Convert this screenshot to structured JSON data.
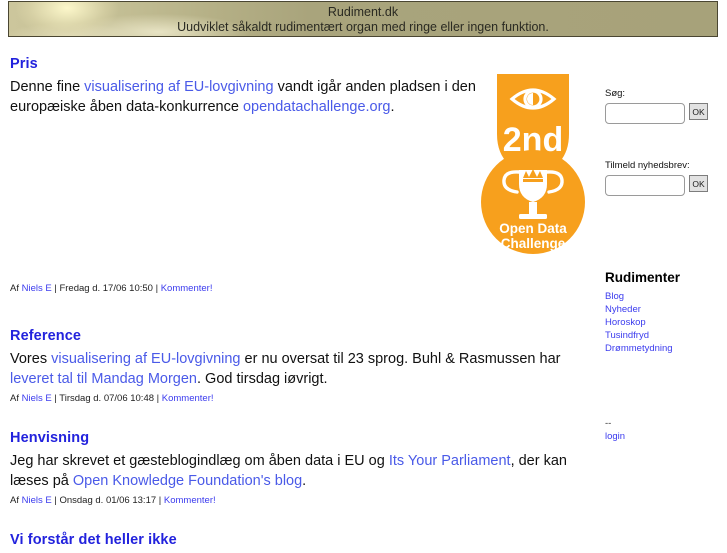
{
  "header": {
    "title": "Rudiment.dk",
    "tagline": "Uudviklet såkaldt rudimentært organ med ringe eller ingen funktion.",
    "banner_color": "#a9a47c",
    "banner_border_color": "#4a4632"
  },
  "theme": {
    "link_color": "#4a5ae8",
    "heading_color": "#2222dd",
    "accent_orange": "#f7a01d",
    "text_color": "#111111"
  },
  "posts": [
    {
      "id": "pris",
      "title": "Pris",
      "body_parts": [
        {
          "type": "text",
          "value": "Denne fine "
        },
        {
          "type": "link",
          "value": "visualisering af EU-lovgivning"
        },
        {
          "type": "text",
          "value": " vandt igår anden pladsen i den europæiske åben data-konkurrence "
        },
        {
          "type": "link",
          "value": "opendatachallenge.org"
        },
        {
          "type": "text",
          "value": "."
        }
      ],
      "meta": {
        "by_label": "Af",
        "author": "Niels E",
        "sep": "|",
        "date": "Fredag d. 17/06 10:50",
        "comment_label": "Kommenter!"
      }
    },
    {
      "id": "reference",
      "title": "Reference",
      "body_parts": [
        {
          "type": "text",
          "value": "Vores "
        },
        {
          "type": "link",
          "value": "visualisering af EU-lovgivning"
        },
        {
          "type": "text",
          "value": " er nu oversat til 23 sprog. Buhl & Rasmussen har "
        },
        {
          "type": "link",
          "value": "leveret tal til Mandag Morgen"
        },
        {
          "type": "text",
          "value": ". God tirsdag iøvrigt."
        }
      ],
      "meta": {
        "by_label": "Af",
        "author": "Niels E",
        "sep": "|",
        "date": "Tirsdag d. 07/06 10:48",
        "comment_label": "Kommenter!"
      }
    },
    {
      "id": "henvisning",
      "title": "Henvisning",
      "body_parts": [
        {
          "type": "text",
          "value": "Jeg har skrevet et gæsteblogindlæg om åben data i EU og "
        },
        {
          "type": "link",
          "value": "Its Your Parliament"
        },
        {
          "type": "text",
          "value": ", der kan læses på "
        },
        {
          "type": "link",
          "value": "Open Knowledge Foundation's blog"
        },
        {
          "type": "text",
          "value": "."
        }
      ],
      "meta": {
        "by_label": "Af",
        "author": "Niels E",
        "sep": "|",
        "date": "Onsdag d. 01/06 13:17",
        "comment_label": "Kommenter!"
      }
    },
    {
      "id": "viforstaar",
      "title": "Vi forstår det heller ikke",
      "body_parts": [],
      "meta": null
    }
  ],
  "badge": {
    "place": "2nd",
    "line1": "Open Data",
    "line2": "Challenge",
    "color": "#f7a01d",
    "icon_top": "eye-icon",
    "icon_bottom": "trophy-icon"
  },
  "sidebar": {
    "search": {
      "label": "Søg:",
      "value": "",
      "placeholder": "",
      "button_label": "OK"
    },
    "newsletter": {
      "label": "Tilmeld nyhedsbrev:",
      "value": "",
      "placeholder": "",
      "button_label": "OK"
    },
    "nav": {
      "heading": "Rudimenter",
      "items": [
        {
          "label": "Blog"
        },
        {
          "label": "Nyheder"
        },
        {
          "label": "Horoskop"
        },
        {
          "label": "Tusindfryd"
        },
        {
          "label": "Drømmetydning"
        }
      ]
    },
    "footer": {
      "separator": "--",
      "login_label": "login"
    }
  }
}
